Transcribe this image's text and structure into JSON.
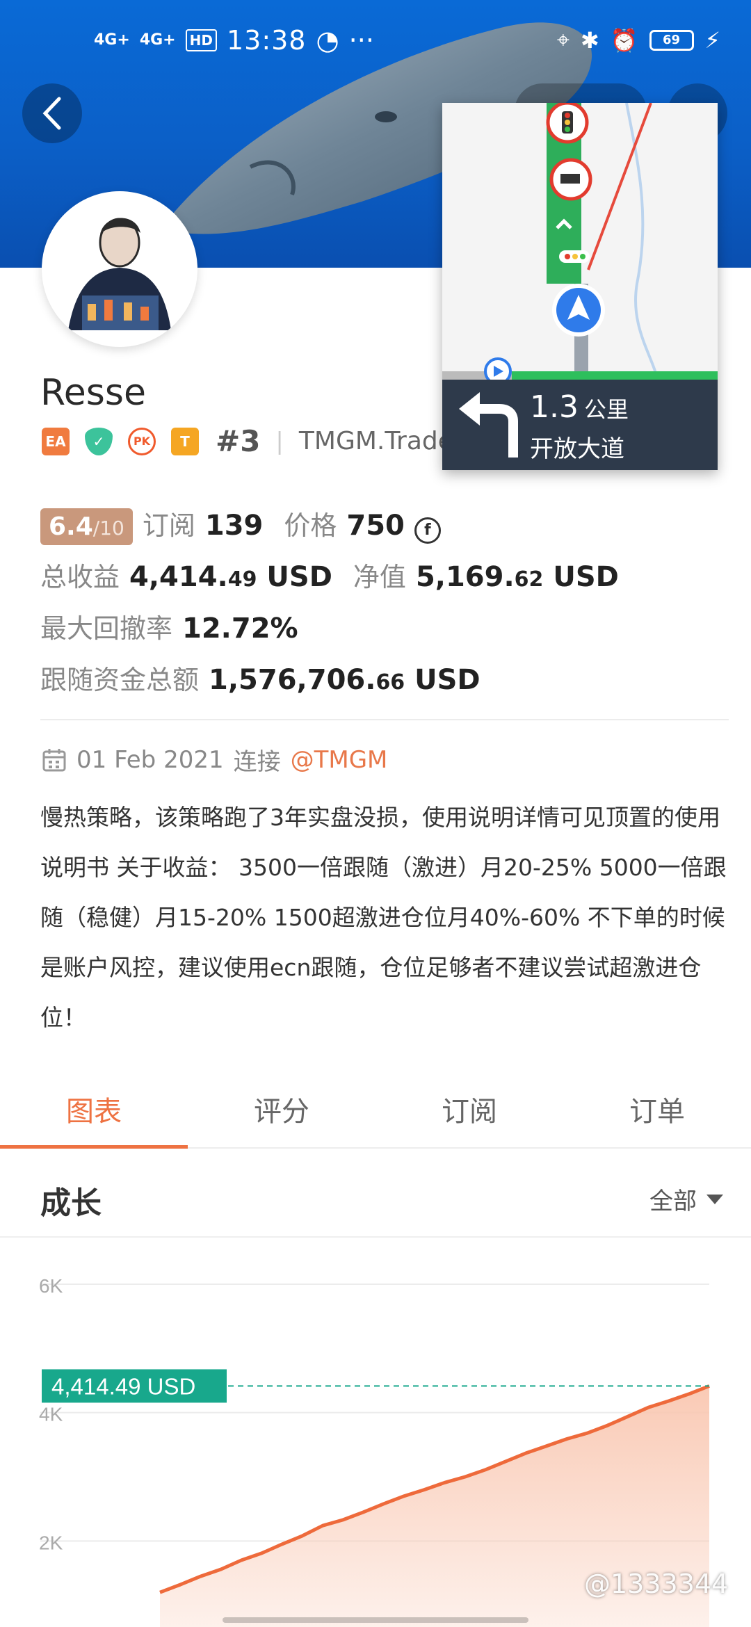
{
  "status_bar": {
    "signal1": "4G+",
    "signal2": "4G+",
    "hd": "HD",
    "time": "13:38",
    "more": "···",
    "battery": "69"
  },
  "profile": {
    "name": "Resse",
    "badges": [
      "EA",
      "PK",
      "T"
    ],
    "rank": "#3",
    "broker": "TMGM.Trade"
  },
  "stats": {
    "score": "6.4",
    "score_of": "/10",
    "subscribe_label": "订阅",
    "subscribe_value": "139",
    "price_label": "价格",
    "price_value": "750",
    "coin_symbol": "f",
    "total_gain_label": "总收益",
    "total_gain_int": "4,414.",
    "total_gain_dec": "49",
    "currency": "USD",
    "equity_label": "净值",
    "equity_int": "5,169.",
    "equity_dec": "62",
    "max_dd_label": "最大回撤率",
    "max_dd_value": "12.72%",
    "follow_label": "跟随资金总额",
    "follow_int": "1,576,706.",
    "follow_dec": "66"
  },
  "connection": {
    "date": "01 Feb 2021",
    "connect_label": "连接",
    "handle": "@TMGM"
  },
  "description": "慢热策略，该策略跑了3年实盘没损，使用说明详情可见顶置的使用说明书 关于收益： 3500一倍跟随（激进）月20-25% 5000一倍跟随（稳健）月15-20% 1500超激进仓位月40%-60% 不下单的时候是账户风控，建议使用ecn跟随，仓位足够者不建议尝试超激进仓位！",
  "tabs": [
    "图表",
    "评分",
    "订阅",
    "订单"
  ],
  "section": {
    "title": "成长",
    "filter": "全部"
  },
  "chart_data": {
    "type": "area",
    "title": "成长",
    "y_ticks": [
      "6K",
      "4K",
      "2K"
    ],
    "ylim": [
      0,
      6000
    ],
    "current_label": "4,414.49 USD",
    "current_value": 4414.49,
    "series": [
      {
        "values": [
          1200,
          1320,
          1450,
          1560,
          1700,
          1810,
          1950,
          2080,
          2240,
          2330,
          2450,
          2580,
          2700,
          2800,
          2910,
          3000,
          3110,
          3240,
          3370,
          3480,
          3590,
          3680,
          3800,
          3940,
          4080,
          4180,
          4290,
          4414.49
        ]
      }
    ],
    "colors": {
      "line": "#ee6a3b",
      "fill": "#f9c7b1",
      "marker": "#18a88c"
    }
  },
  "navigation": {
    "distance": "1.3",
    "unit": "公里",
    "road": "开放大道"
  },
  "watermark": "@1333344"
}
